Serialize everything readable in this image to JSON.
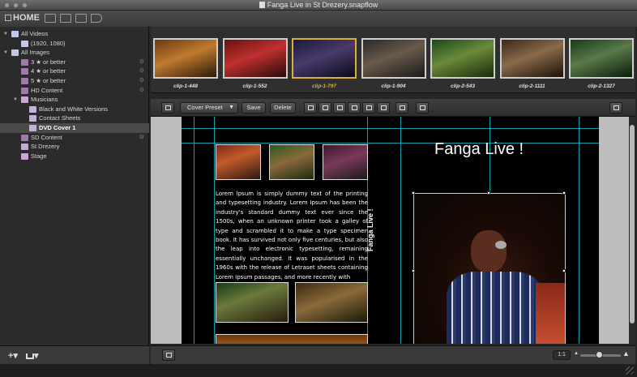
{
  "window": {
    "title": "Fanga Live in St Drezery.snapflow",
    "home_label": "HOME"
  },
  "sidebar": {
    "items": [
      {
        "label": "All Videos",
        "icon": "video-folder-icon"
      },
      {
        "label": "(1920, 1080)",
        "icon": "video-format-icon"
      },
      {
        "label": "All Images",
        "icon": "images-folder-icon"
      },
      {
        "label": "3 ★ or better",
        "icon": "smart-album-icon"
      },
      {
        "label": "4 ★ or better",
        "icon": "smart-album-icon"
      },
      {
        "label": "5 ★ or better",
        "icon": "smart-album-icon"
      },
      {
        "label": "HD Content",
        "icon": "smart-album-icon"
      },
      {
        "label": "Musicians",
        "icon": "folder-icon"
      },
      {
        "label": "Black and White Versions",
        "icon": "album-icon"
      },
      {
        "label": "Contact Sheets",
        "icon": "album-icon"
      },
      {
        "label": "DVD Cover 1",
        "icon": "album-icon"
      },
      {
        "label": "SD Content",
        "icon": "smart-album-icon"
      },
      {
        "label": "St Drezery",
        "icon": "folder-icon"
      },
      {
        "label": "Stage",
        "icon": "folder-icon"
      }
    ],
    "add_label": "+▾",
    "view_label": "▾"
  },
  "filmstrip": {
    "clips": [
      {
        "label": "clip-1-448"
      },
      {
        "label": "clip-1-552"
      },
      {
        "label": "clip-1-797"
      },
      {
        "label": "clip-1-904"
      },
      {
        "label": "clip-2-543"
      },
      {
        "label": "clip-2-1111"
      },
      {
        "label": "clip-2-1327"
      }
    ]
  },
  "edit_toolbar": {
    "preset_label": "Cover Preset",
    "save_label": "Save",
    "delete_label": "Delete"
  },
  "canvas": {
    "title": "Fanga Live !",
    "vertical_title": "Fanga Live !",
    "body_text": "Lorem Ipsum is simply dummy text of the printing and typesetting industry. Lorem Ipsum has been the industry's standard dummy text ever since the 1500s, when an unknown printer took a galley of type and scrambled it to make a type specimen book. It has survived not only five centuries, but also the leap into electronic typesetting, remaining essentially unchanged. It was popularised in the 1960s with the release of Letraset sheets containing Lorem Ipsum passages, and more recently with"
  },
  "bottombar": {
    "zoom_label": "1:1",
    "zoom_fraction": 0.45
  },
  "colors": {
    "guide": "#19b9c8",
    "selection": "#d9b13a"
  }
}
